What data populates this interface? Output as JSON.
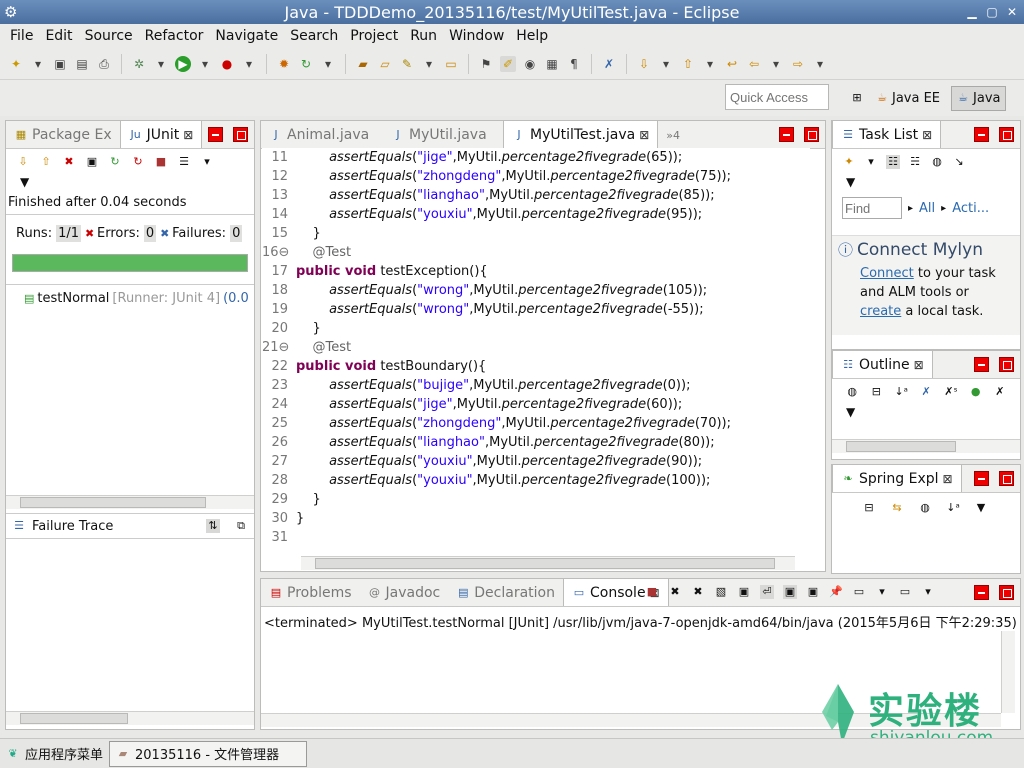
{
  "window": {
    "title": "Java - TDDDemo_20135116/test/MyUtilTest.java - Eclipse"
  },
  "menu": [
    "File",
    "Edit",
    "Source",
    "Refactor",
    "Navigate",
    "Search",
    "Project",
    "Run",
    "Window",
    "Help"
  ],
  "quick_access": {
    "placeholder": "Quick Access"
  },
  "perspectives": [
    {
      "label": "Java EE"
    },
    {
      "label": "Java",
      "active": true
    }
  ],
  "left_view": {
    "tabs": [
      {
        "label": "Package Ex"
      },
      {
        "label": "JUnit",
        "active": true
      }
    ],
    "status": "Finished after 0.04 seconds",
    "runs_label": "Runs:",
    "runs_value": "1/1",
    "errors_label": "Errors:",
    "errors_value": "0",
    "failures_label": "Failures:",
    "failures_value": "0",
    "progress": 1.0,
    "progress_color": "#5cb85c",
    "test_item": "testNormal",
    "test_runner": "[Runner: JUnit 4]",
    "test_time": "(0.0",
    "failure_trace": "Failure Trace"
  },
  "editor": {
    "tabs": [
      {
        "label": "Animal.java"
      },
      {
        "label": "MyUtil.java"
      },
      {
        "label": "MyUtilTest.java",
        "active": true
      }
    ],
    "overflow": "»4",
    "lines": [
      {
        "n": "11",
        "type": "assert",
        "arg": "\"jige\"",
        "val": "(65));"
      },
      {
        "n": "12",
        "type": "assert",
        "arg": "\"zhongdeng\"",
        "val": "(75));"
      },
      {
        "n": "13",
        "type": "assert",
        "arg": "\"lianghao\"",
        "val": "(85));"
      },
      {
        "n": "14",
        "type": "assert",
        "arg": "\"youxiu\"",
        "val": "(95));"
      },
      {
        "n": "15",
        "type": "plain",
        "text": "    }"
      },
      {
        "n": "16⊖",
        "type": "ann",
        "text": "    @Test"
      },
      {
        "n": "17",
        "type": "decl",
        "kw": "public void",
        "name": " testException(){"
      },
      {
        "n": "18",
        "type": "assert",
        "arg": "\"wrong\"",
        "val": "(105));"
      },
      {
        "n": "19",
        "type": "assert",
        "arg": "\"wrong\"",
        "val": "(-55));"
      },
      {
        "n": "20",
        "type": "plain",
        "text": "    }"
      },
      {
        "n": "21⊖",
        "type": "ann",
        "text": "    @Test"
      },
      {
        "n": "22",
        "type": "decl",
        "kw": "public void",
        "name": " testBoundary(){"
      },
      {
        "n": "23",
        "type": "assert",
        "arg": "\"bujige\"",
        "val": "(0));"
      },
      {
        "n": "24",
        "type": "assert",
        "arg": "\"jige\"",
        "val": "(60));"
      },
      {
        "n": "25",
        "type": "assert",
        "arg": "\"zhongdeng\"",
        "val": "(70));"
      },
      {
        "n": "26",
        "type": "assert",
        "arg": "\"lianghao\"",
        "val": "(80));"
      },
      {
        "n": "27",
        "type": "assert",
        "arg": "\"youxiu\"",
        "val": "(90));"
      },
      {
        "n": "28",
        "type": "assert",
        "arg": "\"youxiu\"",
        "val": "(100));"
      },
      {
        "n": "29",
        "type": "plain",
        "text": "    }"
      },
      {
        "n": "30",
        "type": "plain",
        "text": "}"
      },
      {
        "n": "31",
        "type": "plain",
        "text": ""
      }
    ],
    "assert_fn": "assertEquals",
    "call_prefix": ",MyUtil.",
    "call_fn": "percentage2fivegrade"
  },
  "task_list": {
    "tab": "Task List",
    "find_placeholder": "Find",
    "all": "All",
    "acti": "Acti..."
  },
  "mylyn": {
    "title": "Connect Mylyn",
    "link1": "Connect",
    "text1": " to your task and ALM tools or ",
    "link2": "create",
    "text2": " a local task."
  },
  "outline": {
    "tab": "Outline"
  },
  "spring": {
    "tab": "Spring Expl"
  },
  "bottom": {
    "tabs": [
      {
        "label": "Problems"
      },
      {
        "label": "Javadoc"
      },
      {
        "label": "Declaration"
      },
      {
        "label": "Console",
        "active": true
      }
    ],
    "console_line": "<terminated> MyUtilTest.testNormal [JUnit] /usr/lib/jvm/java-7-openjdk-amd64/bin/java (2015年5月6日 下午2:29:35)"
  },
  "taskbar": {
    "start": "应用程序菜单",
    "window": "20135116 - 文件管理器"
  },
  "watermark": {
    "brand": "实验楼",
    "url": "shiyanlou.com",
    "color": "#2fb17e"
  }
}
